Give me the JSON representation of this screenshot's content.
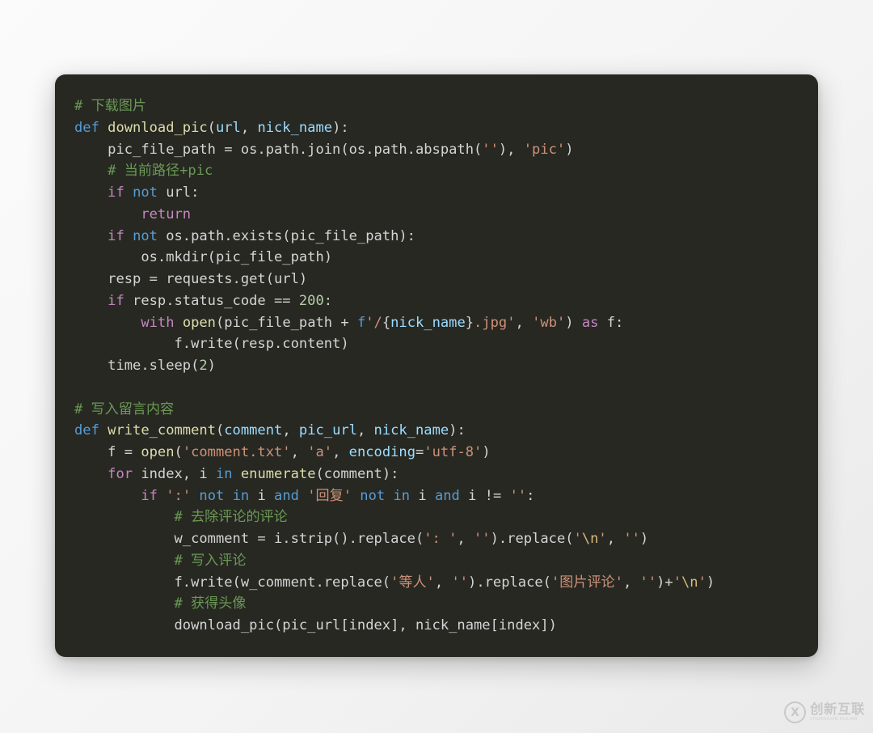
{
  "document": {
    "type": "python-code-snippet",
    "background_color": "#f4f4f4",
    "card": {
      "background_color": "#272822",
      "corner_radius_px": 13
    },
    "syntax_colors": {
      "comment": "#6a9955",
      "control_keyword": "#c586c0",
      "keyword": "#569cd6",
      "function": "#dcdcaa",
      "parameter": "#9cdcfe",
      "string": "#ce9178",
      "escape": "#d7ba7d",
      "number": "#b5cea8",
      "plain": "#d4d4d4"
    },
    "lines": [
      "# 下载图片",
      "def download_pic(url, nick_name):",
      "    pic_file_path = os.path.join(os.path.abspath(''), 'pic')",
      "    # 当前路径+pic",
      "    if not url:",
      "        return",
      "    if not os.path.exists(pic_file_path):",
      "        os.mkdir(pic_file_path)",
      "    resp = requests.get(url)",
      "    if resp.status_code == 200:",
      "        with open(pic_file_path + f'/{nick_name}.jpg', 'wb') as f:",
      "            f.write(resp.content)",
      "    time.sleep(2)",
      "",
      "# 写入留言内容",
      "def write_comment(comment, pic_url, nick_name):",
      "    f = open('comment.txt', 'a', encoding='utf-8')",
      "    for index, i in enumerate(comment):",
      "        if ':' not in i and '回复' not in i and i != '':",
      "            # 去除评论的评论",
      "            w_comment = i.strip().replace(': ', '').replace('\\n', '')",
      "            # 写入评论",
      "            f.write(w_comment.replace('等人', '').replace('图片评论', '')+'\\n')",
      "            # 获得头像",
      "            download_pic(pic_url[index], nick_name[index])"
    ]
  },
  "watermark": {
    "logo_glyph": "X",
    "brand_cn": "创新互联",
    "brand_pinyin": "CHUANGXIN HULIAN"
  }
}
